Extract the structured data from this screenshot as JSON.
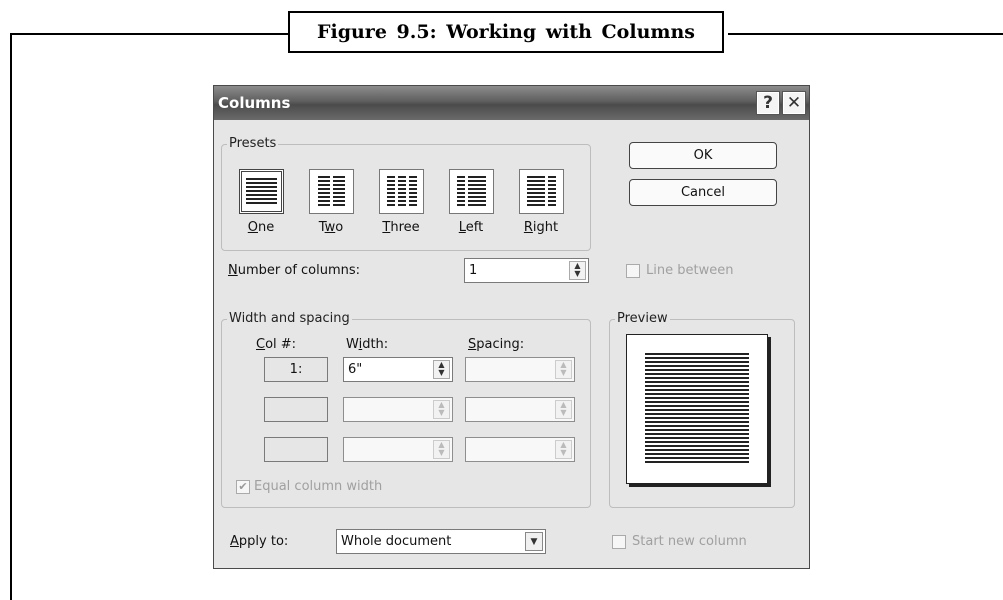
{
  "caption": "Figure 9.5: Working with Columns",
  "dialog": {
    "title": "Columns",
    "help_glyph": "?",
    "close_glyph": "✕"
  },
  "presets": {
    "group_label": "Presets",
    "items": [
      {
        "label": "One",
        "selected": true
      },
      {
        "label": "Two",
        "selected": false
      },
      {
        "label": "Three",
        "selected": false
      },
      {
        "label": "Left",
        "selected": false
      },
      {
        "label": "Right",
        "selected": false
      }
    ]
  },
  "buttons": {
    "ok": "OK",
    "cancel": "Cancel"
  },
  "number_of_columns": {
    "label": "Number of columns:",
    "value": "1"
  },
  "line_between": {
    "label": "Line between",
    "checked": false,
    "enabled": false
  },
  "width_spacing": {
    "group_label": "Width and spacing",
    "headers": {
      "col": "Col #:",
      "width": "Width:",
      "spacing": "Spacing:"
    },
    "rows": [
      {
        "col": "1:",
        "width": "6\"",
        "spacing": ""
      },
      {
        "col": "",
        "width": "",
        "spacing": ""
      },
      {
        "col": "",
        "width": "",
        "spacing": ""
      }
    ]
  },
  "equal_column_width": {
    "label": "Equal column width",
    "checked": true,
    "enabled": false
  },
  "preview": {
    "group_label": "Preview"
  },
  "apply_to": {
    "label": "Apply to:",
    "value": "Whole document"
  },
  "start_new_column": {
    "label": "Start new column",
    "checked": false,
    "enabled": false
  },
  "colors": {
    "title_bar": "#5e5e5e",
    "dialog_bg": "#e6e6e6"
  }
}
